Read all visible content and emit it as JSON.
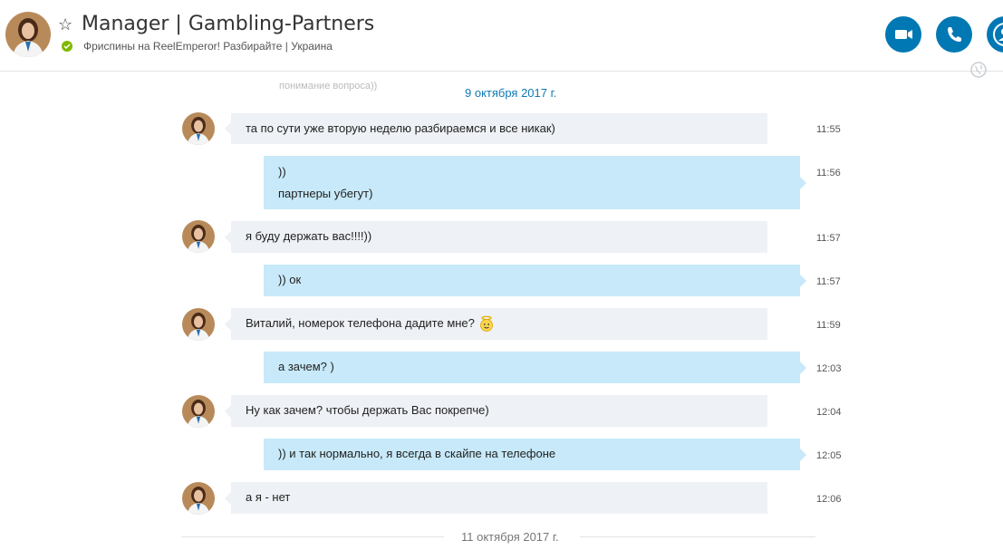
{
  "header": {
    "name": "Manager | Gambling-Partners",
    "mood": "Фриспины на ReelEmperor! Разбирайте  |  Украина",
    "status_color": "#7fba00",
    "accent_color": "#0078b4"
  },
  "conversation": {
    "ghost_text": "понимание вопроса))",
    "date_1": "9 октября 2017 г.",
    "date_2": "11 октября 2017 г.",
    "messages": [
      {
        "dir": "in",
        "text": "та по сути уже вторую неделю разбираемся и все никак)",
        "time": "11:55"
      },
      {
        "dir": "out",
        "line1": "))",
        "line2": "партнеры убегут)",
        "time": "11:56"
      },
      {
        "dir": "in",
        "text": "я буду держать вас!!!!))",
        "time": "11:57"
      },
      {
        "dir": "out",
        "text": ")) ок",
        "time": "11:57"
      },
      {
        "dir": "in",
        "text": "Виталий, номерок телефона дадите мне?",
        "emoticon": "angel-emoticon",
        "time": "11:59"
      },
      {
        "dir": "out",
        "text": "а зачем? )",
        "time": "12:03"
      },
      {
        "dir": "in",
        "text": "Ну как зачем? чтобы держать Вас покрепче)",
        "time": "12:04"
      },
      {
        "dir": "out",
        "text": ")) и так нормально, я всегда в скайпе на телефоне",
        "time": "12:05"
      },
      {
        "dir": "in",
        "text": "а я - нет",
        "time": "12:06"
      }
    ]
  }
}
